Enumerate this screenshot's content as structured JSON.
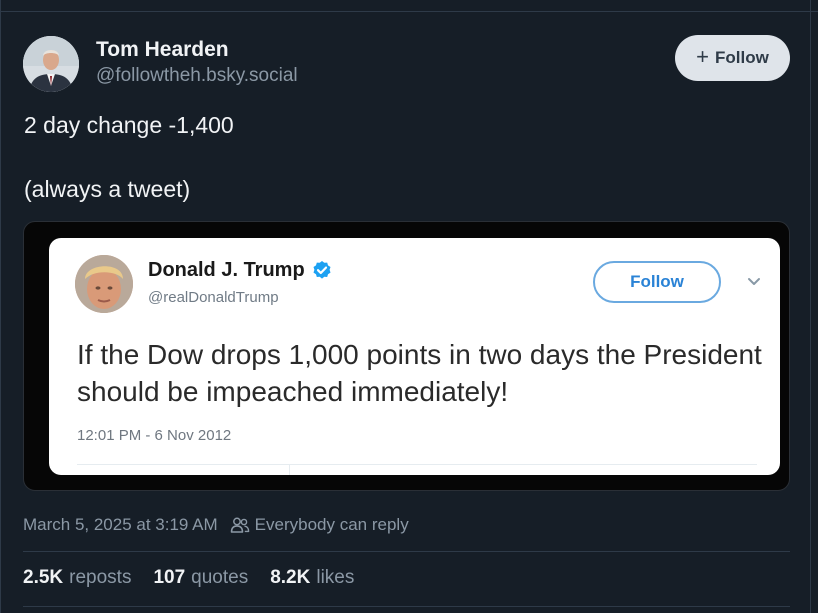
{
  "post": {
    "author_name": "Tom Hearden",
    "author_handle": "@followtheh.bsky.social",
    "follow_label": "Follow",
    "text_line1": "2 day change -1,400",
    "text_line2": "(always a tweet)",
    "timestamp": "March 5, 2025 at 3:19 AM",
    "reply_setting": "Everybody can reply"
  },
  "embedded_tweet": {
    "name": "Donald J. Trump",
    "handle": "@realDonaldTrump",
    "follow_label": "Follow",
    "text": "If the Dow drops 1,000 points in two days the President should be impeached immediately!",
    "time": "12:01 PM - 6 Nov 2012",
    "verified_color": "#1da1f2"
  },
  "stats": {
    "reposts_count": "2.5K",
    "reposts_label": "reposts",
    "quotes_count": "107",
    "quotes_label": "quotes",
    "likes_count": "8.2K",
    "likes_label": "likes"
  },
  "icons": {
    "follow": "plus-icon",
    "reply_setting": "people-icon",
    "verified": "verified-badge-icon",
    "menu": "chevron-down-icon"
  },
  "colors": {
    "background": "#161e27",
    "follow_button_bg": "#dfe4ea",
    "muted_text": "#8b98a5",
    "tweet_follow_blue": "#2a83d6"
  }
}
